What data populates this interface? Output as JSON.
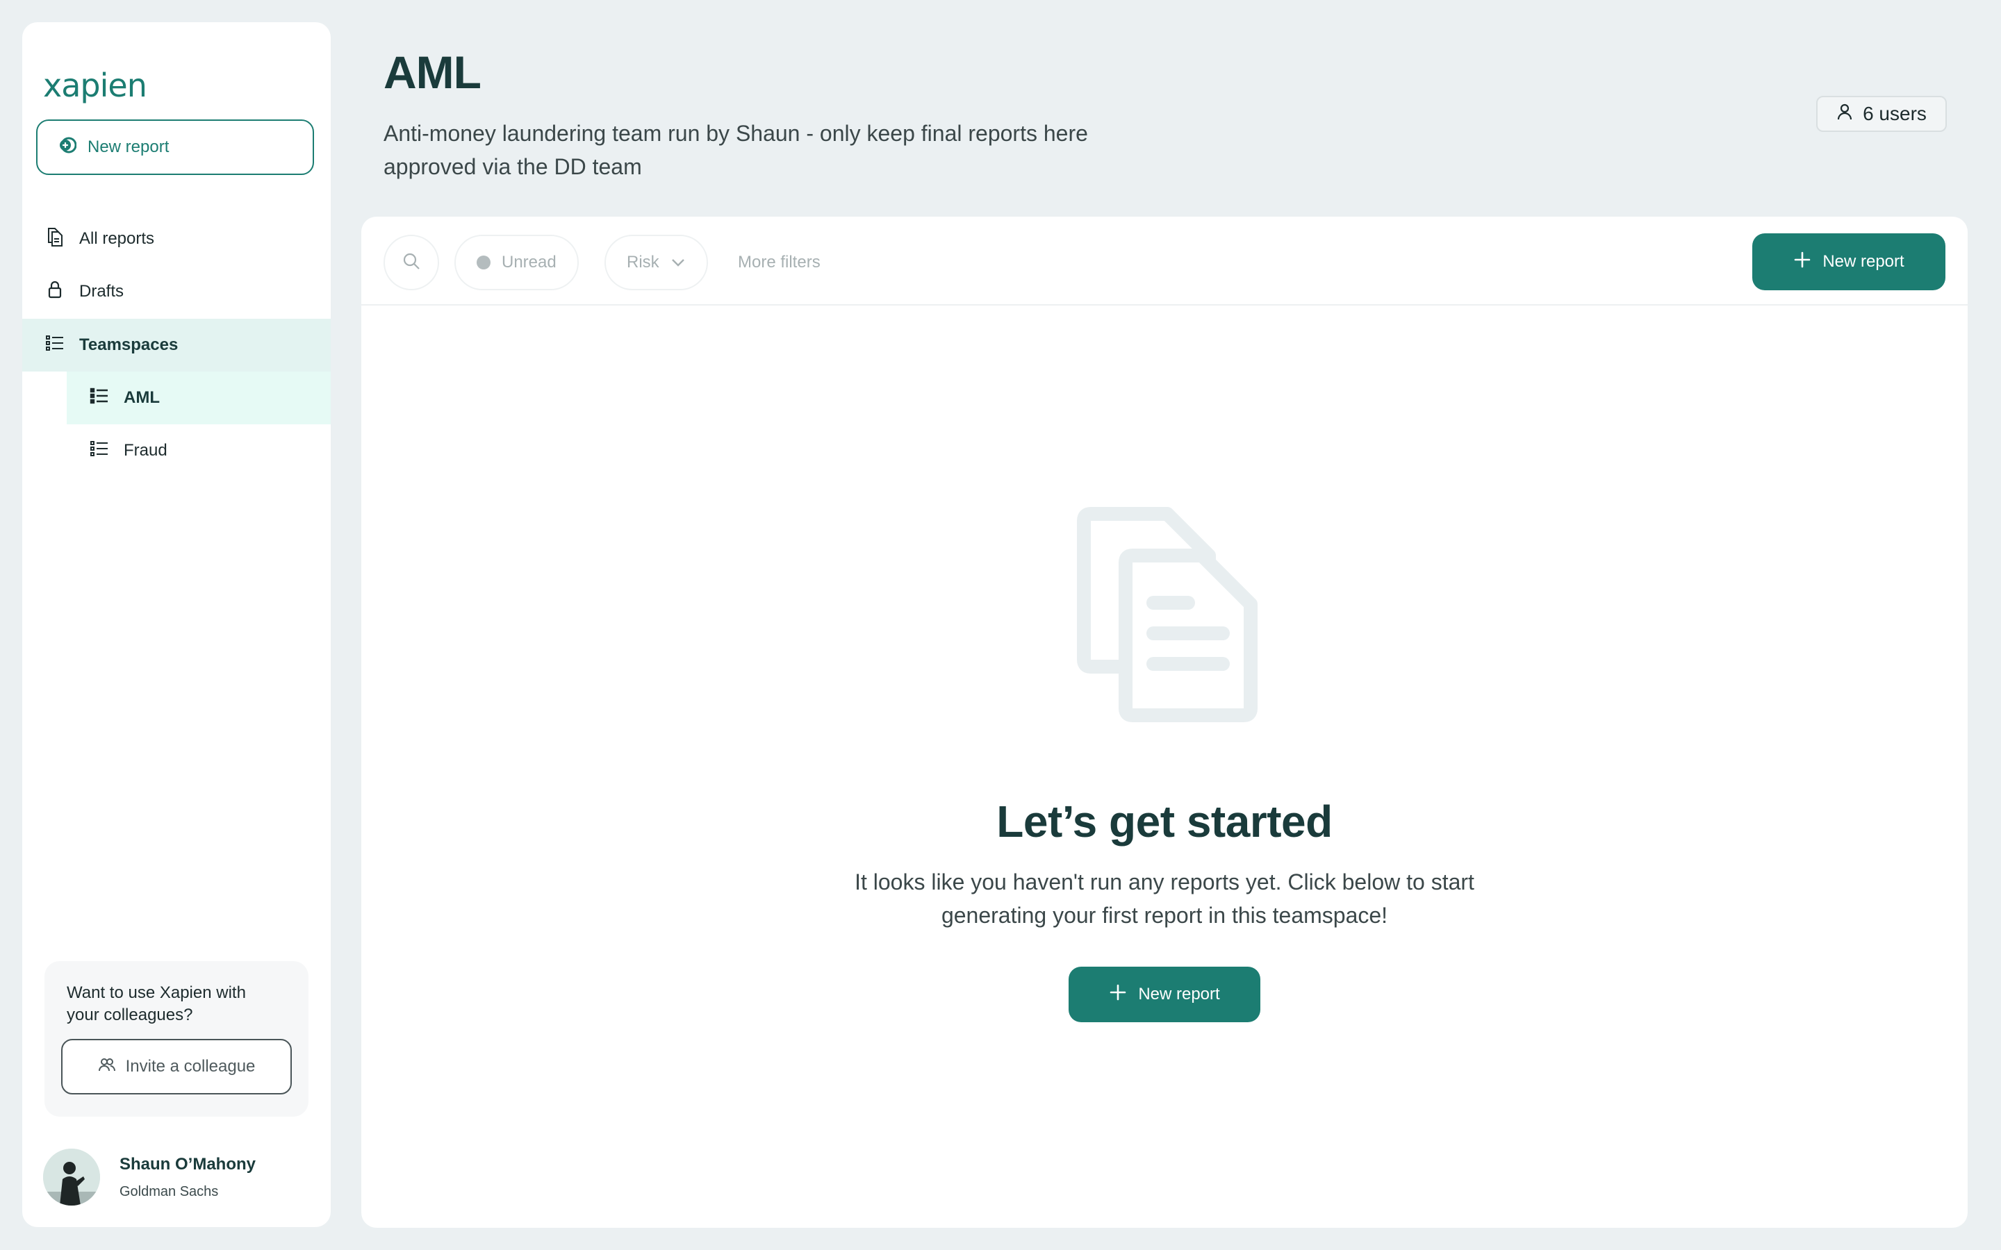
{
  "sidebar": {
    "logo": "xapien",
    "new_report_label": "New report",
    "nav": {
      "all_reports": "All reports",
      "drafts": "Drafts",
      "teamspaces": "Teamspaces"
    },
    "teamspaces": [
      {
        "label": "AML",
        "active": true
      },
      {
        "label": "Fraud",
        "active": false
      }
    ],
    "invite": {
      "prompt": "Want to use Xapien with your colleagues?",
      "button_label": "Invite a colleague"
    },
    "user": {
      "name": "Shaun O’Mahony",
      "organization": "Goldman Sachs"
    }
  },
  "header": {
    "title": "AML",
    "description": "Anti-money laundering team run by Shaun - only keep final reports here approved via the DD team",
    "users_badge": "6 users"
  },
  "filters": {
    "unread_label": "Unread",
    "risk_label": "Risk",
    "more_filters_label": "More filters",
    "new_report_label": "New report"
  },
  "empty_state": {
    "title": "Let’s get started",
    "text": "It looks like you haven't run any reports yet. Click below to start generating your first report in this teamspace!",
    "button_label": "New report"
  },
  "colors": {
    "accent": "#1c7d72",
    "background": "#ebf0f2",
    "active_nav": "#e3f3f1",
    "active_subnav": "#e6faf5"
  }
}
